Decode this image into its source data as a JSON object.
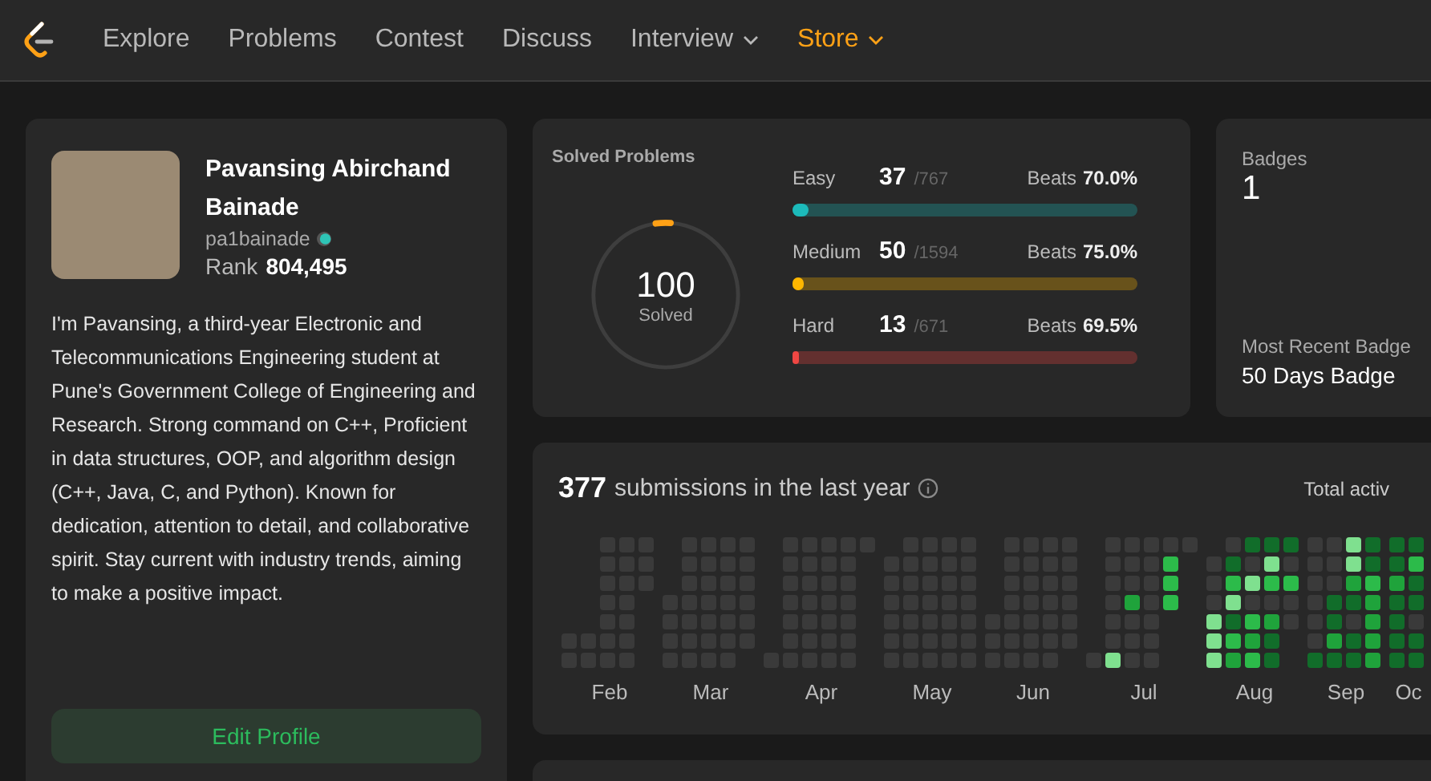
{
  "nav": {
    "items": [
      {
        "label": "Explore",
        "dropdown": false,
        "accent": false
      },
      {
        "label": "Problems",
        "dropdown": false,
        "accent": false
      },
      {
        "label": "Contest",
        "dropdown": false,
        "accent": false
      },
      {
        "label": "Discuss",
        "dropdown": false,
        "accent": false
      },
      {
        "label": "Interview",
        "dropdown": true,
        "accent": false
      },
      {
        "label": "Store",
        "dropdown": true,
        "accent": true
      }
    ]
  },
  "profile": {
    "name": "Pavansing Abirchand Bainade",
    "username": "pa1bainade",
    "rank_label": "Rank",
    "rank": "804,495",
    "bio": "I'm Pavansing, a third-year Electronic and Telecommunications Engineering student at Pune's Government College of Engineering and Research. Strong command on C++, Proficient in data structures, OOP, and algorithm design (C++, Java, C, and Python). Known for dedication, attention to detail, and collaborative spirit. Stay current with industry trends, aiming to make a positive impact.",
    "edit_button": "Edit Profile"
  },
  "solved": {
    "title": "Solved Problems",
    "total": "100",
    "total_label": "Solved",
    "level": 0.033,
    "difficulties": [
      {
        "label": "Easy",
        "solved": "37",
        "total": "/767",
        "beats_label": "Beats",
        "beats": "70.0%",
        "level": 0.048,
        "color": "#1cbaba"
      },
      {
        "label": "Medium",
        "solved": "50",
        "total": "/1594",
        "beats_label": "Beats",
        "beats": "75.0%",
        "level": 0.031,
        "color": "#ffb700"
      },
      {
        "label": "Hard",
        "solved": "13",
        "total": "/671",
        "beats_label": "Beats",
        "beats": "69.5%",
        "level": 0.019,
        "color": "#ef4743"
      }
    ]
  },
  "badges": {
    "title": "Badges",
    "count": "1",
    "recent_label": "Most Recent Badge",
    "recent": "50 Days Badge"
  },
  "submissions": {
    "count": "377",
    "label": "submissions in the last year",
    "right_label": "Total activ",
    "months": [
      "Feb",
      "Mar",
      "Apr",
      "May",
      "Jun",
      "Jul",
      "Aug",
      "Sep",
      "Oc"
    ]
  }
}
